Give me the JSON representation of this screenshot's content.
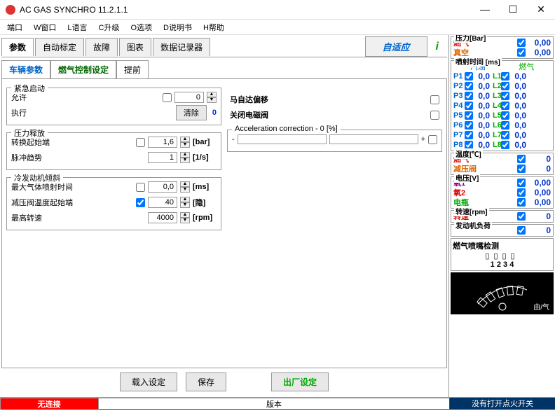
{
  "title": "AC GAS SYNCHRO  11.2.1.1",
  "menu": [
    "端口",
    "W窗口",
    "L语言",
    "C升级",
    "O选项",
    "D说明书",
    "H帮助"
  ],
  "tabs": {
    "items": [
      "参数",
      "自动标定",
      "故障",
      "图表",
      "数据记录器"
    ],
    "adapt": "自适应"
  },
  "subtabs": [
    "车辆参数",
    "燃气控制设定",
    "提前"
  ],
  "groups": {
    "emergency": {
      "title": "紧急启动",
      "allow": "允许",
      "exec": "执行",
      "clear": "清除",
      "val": "0"
    },
    "pressure": {
      "title": "压力释放",
      "start": "转换起始端",
      "startVal": "1,6",
      "startUnit": "[bar]",
      "pulse": "脉冲趋势",
      "pulseVal": "1",
      "pulseUnit": "[1/s]"
    },
    "cold": {
      "title": "冷发动机倾斜",
      "maxInj": "最大气体喷射时间",
      "maxInjVal": "0,0",
      "maxInjUnit": "[ms]",
      "reducer": "减压阀温度起始端",
      "reducerVal": "40",
      "reducerUnit": "[隐]",
      "maxRpm": "最高转速",
      "maxRpmVal": "4000",
      "maxRpmUnit": "[rpm]"
    },
    "mazda": "马自达偏移",
    "closeValve": "关闭电磁阀",
    "accel": {
      "title": "Acceleration correction - 0 [%]",
      "minus": "-",
      "plus": "+"
    }
  },
  "buttons": {
    "load": "载入设定",
    "save": "保存",
    "factory": "出厂设定"
  },
  "status": {
    "noconn": "无连接",
    "version": "版本",
    "msg": "没有打开点火开关"
  },
  "right": {
    "pressure": {
      "t": "压力[Bar]",
      "gas": "燃气",
      "vac": "真空",
      "gasVal": "0,00",
      "vacVal": "0,00"
    },
    "injtime": {
      "t": "喷射时间 [ms]",
      "petrol": "汽油",
      "gas": "燃气",
      "P": [
        {
          "n": "P1",
          "v": "0,0"
        },
        {
          "n": "P2",
          "v": "0,0"
        },
        {
          "n": "P3",
          "v": "0,0"
        },
        {
          "n": "P4",
          "v": "0,0"
        },
        {
          "n": "P5",
          "v": "0,0"
        },
        {
          "n": "P6",
          "v": "0,0"
        },
        {
          "n": "P7",
          "v": "0,0"
        },
        {
          "n": "P8",
          "v": "0,0"
        }
      ],
      "L": [
        {
          "n": "L1",
          "v": "0,0"
        },
        {
          "n": "L2",
          "v": "0,0"
        },
        {
          "n": "L3",
          "v": "0,0"
        },
        {
          "n": "L4",
          "v": "0,0"
        },
        {
          "n": "L5",
          "v": "0,0"
        },
        {
          "n": "L6",
          "v": "0,0"
        },
        {
          "n": "L7",
          "v": "0,0"
        },
        {
          "n": "L8",
          "v": "0,0"
        }
      ]
    },
    "temp": {
      "t": "温度[℃]",
      "gas": "燃气",
      "red": "减压阀",
      "gasVal": "0",
      "redVal": "0"
    },
    "volt": {
      "t": "电压[V]",
      "o1": "氧1",
      "o2": "氧2",
      "bat": "电瓶",
      "o1Val": "0,00",
      "o2Val": "0,00",
      "batVal": "0,00"
    },
    "rpm": {
      "t": "转速[rpm]",
      "lbl": "转速",
      "val": "0"
    },
    "load": {
      "t": "发动机负荷",
      "val": "0"
    },
    "injtest": {
      "t": "燃气喷嘴检测",
      "nums": "1  2  3  4"
    },
    "gauge": "由/气"
  }
}
